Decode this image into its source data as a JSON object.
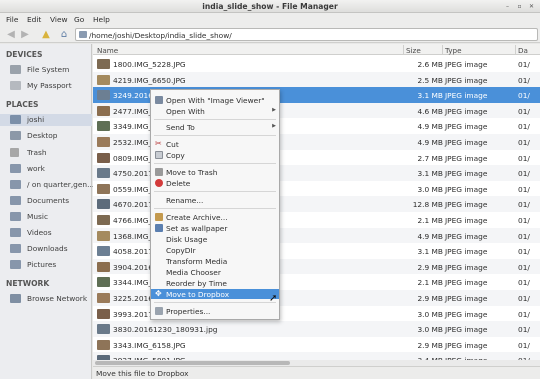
{
  "window": {
    "title": "india_slide_show - File Manager"
  },
  "menu": [
    "File",
    "Edit",
    "View",
    "Go",
    "Help"
  ],
  "toolbar": {
    "path": "/home/joshi/Desktop/india_slide_show/"
  },
  "sidebar": {
    "devices_heading": "DEVICES",
    "devices": [
      "File System",
      "My Passport"
    ],
    "places_heading": "PLACES",
    "places": [
      "joshi",
      "Desktop",
      "Trash",
      "work",
      "/ on quarter,gen...",
      "Documents",
      "Music",
      "Videos",
      "Downloads",
      "Pictures"
    ],
    "network_heading": "NETWORK",
    "network": [
      "Browse Network"
    ]
  },
  "columns": {
    "name": "Name",
    "size": "Size",
    "type": "Type",
    "date": "Da"
  },
  "files": [
    {
      "name": "1800.IMG_5228.JPG",
      "size": "2.6 MB",
      "type": "JPEG image",
      "date": "01/"
    },
    {
      "name": "4219.IMG_6650.JPG",
      "size": "2.5 MB",
      "type": "JPEG image",
      "date": "01/"
    },
    {
      "name": "3249.20161",
      "size": "3.1 MB",
      "type": "JPEG image",
      "date": "01/"
    },
    {
      "name": "2477.IMG_",
      "size": "4.6 MB",
      "type": "JPEG image",
      "date": "01/"
    },
    {
      "name": "3349.IMG_6",
      "size": "4.9 MB",
      "type": "JPEG image",
      "date": "01/"
    },
    {
      "name": "2532.IMG_4",
      "size": "4.9 MB",
      "type": "JPEG image",
      "date": "01/"
    },
    {
      "name": "0809.IMG_4",
      "size": "2.7 MB",
      "type": "JPEG image",
      "date": "01/"
    },
    {
      "name": "4750.2017C",
      "size": "3.1 MB",
      "type": "JPEG image",
      "date": "01/"
    },
    {
      "name": "0559.IMG_4",
      "size": "3.0 MB",
      "type": "JPEG image",
      "date": "01/"
    },
    {
      "name": "4670.2017C",
      "size": "12.8 MB",
      "type": "JPEG image",
      "date": "01/"
    },
    {
      "name": "4766.IMG_2",
      "size": "2.1 MB",
      "type": "JPEG image",
      "date": "01/"
    },
    {
      "name": "1368.IMG_4",
      "size": "4.9 MB",
      "type": "JPEG image",
      "date": "01/"
    },
    {
      "name": "4058.2017C",
      "size": "3.1 MB",
      "type": "JPEG image",
      "date": "01/"
    },
    {
      "name": "3904.20161",
      "size": "2.9 MB",
      "type": "JPEG image",
      "date": "01/"
    },
    {
      "name": "3344.IMG_2",
      "size": "2.1 MB",
      "type": "JPEG image",
      "date": "01/"
    },
    {
      "name": "3225.20161",
      "size": "2.9 MB",
      "type": "JPEG image",
      "date": "01/"
    },
    {
      "name": "3993.2017C",
      "size": "3.0 MB",
      "type": "JPEG image",
      "date": "01/"
    },
    {
      "name": "3830.20161230_180931.jpg",
      "size": "3.0 MB",
      "type": "JPEG image",
      "date": "01/"
    },
    {
      "name": "3343.IMG_6158.JPG",
      "size": "2.9 MB",
      "type": "JPEG image",
      "date": "01/"
    },
    {
      "name": "2927.IMG_5891.JPG",
      "size": "3.4 MB",
      "type": "JPEG image",
      "date": "01/"
    }
  ],
  "context_menu": {
    "open_with_default": "Open With \"Image Viewer\"",
    "open_with": "Open With",
    "send_to": "Send To",
    "cut": "Cut",
    "copy": "Copy",
    "move_to_trash": "Move to Trash",
    "delete": "Delete",
    "rename": "Rename...",
    "create_archive": "Create Archive...",
    "set_wallpaper": "Set as wallpaper",
    "disk_usage": "Disk Usage",
    "copydir": "CopyDIr",
    "transform_media": "Transform Media",
    "media_chooser": "Media Chooser",
    "reorder_by_time": "Reorder by Time",
    "move_to_dropbox": "Move to Dropbox",
    "properties": "Properties..."
  },
  "status": "Move this file to Dropbox",
  "colors": {
    "selection": "#4a90d9",
    "sidebar_bg": "#ecedf0"
  }
}
